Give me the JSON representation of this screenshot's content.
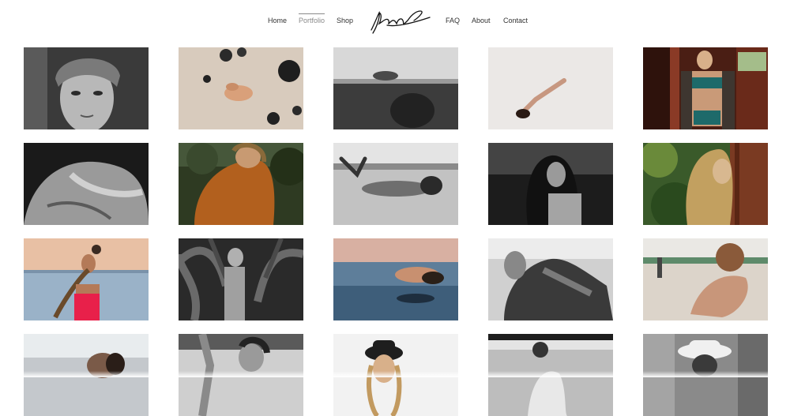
{
  "nav": {
    "left": [
      "Home",
      "Portfolio",
      "Shop"
    ],
    "right": [
      "FAQ",
      "About",
      "Contact"
    ],
    "active": "Portfolio"
  },
  "logo": {
    "text": "Lina Angel",
    "type": "handwritten-signature"
  },
  "gallery": {
    "columns": 5,
    "rows": 4,
    "photos": [
      {
        "icon": "portrait-headscarf-bw"
      },
      {
        "icon": "woman-lying-on-sand-color"
      },
      {
        "icon": "woman-floating-underwater-bw"
      },
      {
        "icon": "woman-on-white-sand-color"
      },
      {
        "icon": "woman-teal-bikini-wooden-door"
      },
      {
        "icon": "woman-back-closeup-bw"
      },
      {
        "icon": "woman-orange-swimsuit-trees"
      },
      {
        "icon": "woman-lying-on-beach-bw"
      },
      {
        "icon": "woman-dark-hair-bw"
      },
      {
        "icon": "woman-behind-door-greenery"
      },
      {
        "icon": "woman-pink-swimsuit-sunset-sea"
      },
      {
        "icon": "woman-in-tropical-plants-bw"
      },
      {
        "icon": "woman-floating-in-sea-dusk"
      },
      {
        "icon": "woman-reclining-on-sand-bw"
      },
      {
        "icon": "woman-sitting-on-beach-color"
      },
      {
        "icon": "woman-face-up-sun-glare"
      },
      {
        "icon": "woman-arm-raised-bw"
      },
      {
        "icon": "woman-black-hat-portrait"
      },
      {
        "icon": "woman-on-sand-dunes-bw"
      },
      {
        "icon": "man-white-hat-portrait-bw"
      }
    ]
  },
  "colors": {
    "background": "#ffffff",
    "nav_text": "#333333",
    "nav_active": "#8a8a8a"
  }
}
